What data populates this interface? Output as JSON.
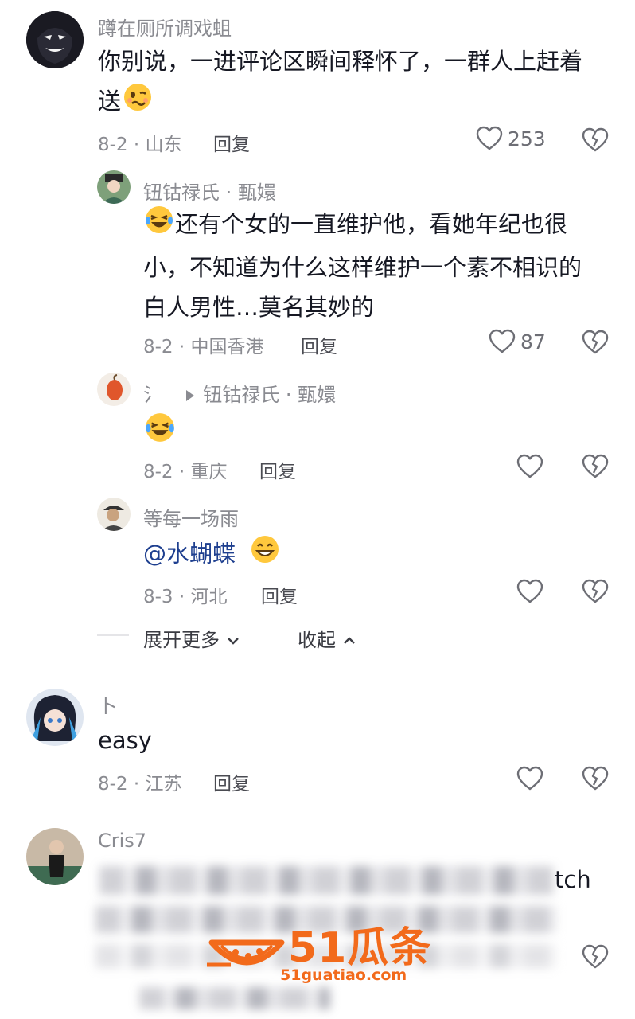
{
  "comments": [
    {
      "username": "蹲在厕所调戏蛆",
      "text": "你别说，一进评论区瞬间释怀了，一群人上赶着",
      "text2": "送",
      "date": "8-2 · 山东",
      "reply": "回复",
      "likes": "253"
    }
  ],
  "replies": [
    {
      "username": "钮钴禄氏 · 甄嬛",
      "line1": "还有个女的一直维护他，看她年纪也很",
      "line2": "小，不知道为什么这样维护一个素不相识的",
      "line3": "白人男性…莫名其妙的",
      "date": "8-2 · 中国香港",
      "reply": "回复",
      "likes": "87"
    },
    {
      "username": "氵",
      "reply_to": "钮钴禄氏 · 甄嬛",
      "date": "8-2 · 重庆",
      "reply": "回复"
    },
    {
      "username": "等每一场雨",
      "mention": "@水蝴蝶",
      "date": "8-3 · 河北",
      "reply": "回复"
    }
  ],
  "controls": {
    "expand_more": "展开更多",
    "collapse": "收起"
  },
  "comment2": {
    "username": "卜",
    "text": "easy",
    "date": "8-2 · 江苏",
    "reply": "回复"
  },
  "comment3": {
    "username": "Cris7",
    "visible_tail": "tch"
  },
  "watermark": {
    "brand": "51瓜条",
    "url": "51guatiao.com",
    "color": "#f26a1b"
  },
  "icons": [
    "heart-outline-icon",
    "broken-heart-icon",
    "play-triangle-icon",
    "chevron-down-icon",
    "chevron-up-icon"
  ]
}
